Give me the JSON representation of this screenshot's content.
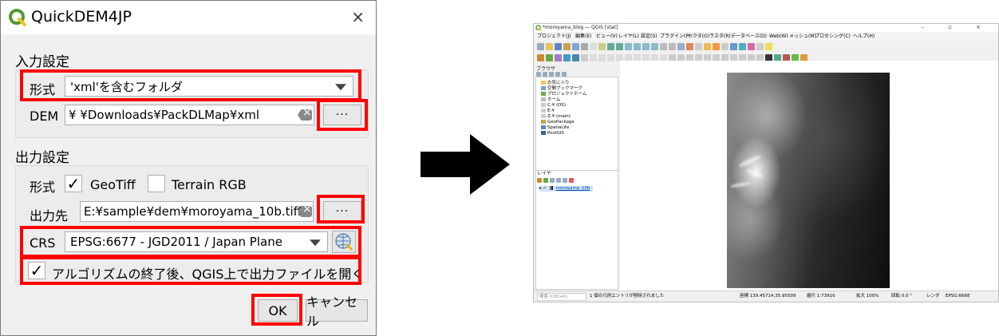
{
  "dialog": {
    "title": "QuickDEM4JP",
    "close": "×",
    "input_section": {
      "title": "入力設定",
      "format_label": "形式",
      "format_value": "'xml'を含むフォルダ",
      "dem_label": "DEM",
      "dem_path": "¥          ¥Downloads¥PackDLMap¥xml",
      "browse_label": "···"
    },
    "output_section": {
      "title": "出力設定",
      "format_label": "形式",
      "geotiff_label": "GeoTiff",
      "geotiff_checked": "✓",
      "terrain_label": "Terrain RGB",
      "output_label": "出力先",
      "output_path": "E:¥sample¥dem¥moroyama_10b.tiff",
      "browse_label": "···",
      "crs_label": "CRS",
      "crs_value": "EPSG:6677 - JGD2011 / Japan Plane",
      "open_check": "✓",
      "open_label": "アルゴリズムの終了後、QGIS上で出力ファイルを開く"
    },
    "ok_label": "OK",
    "cancel_label": "キャンセル"
  },
  "qgis": {
    "title": "*moroyama_blog — QGIS [stat]",
    "window_controls": "–  ▫  ×",
    "menu": [
      "プロジェクト(J)",
      "編集(E)",
      "ビュー(V)",
      "レイヤ(L)",
      "設定(S)",
      "プラグイン(P)",
      "ベクタ(O)",
      "ラスタ(R)",
      "データベース(D)",
      "Web(W)",
      "メッシュ(M)",
      "プロセシング(C)",
      "ヘルプ(H)"
    ],
    "browser_title": "ブラウザ",
    "browser_items": [
      "お気に入り",
      "空間ブックマーク",
      "プロジェクトホーム",
      "ホーム",
      "C:¥ (OS)",
      "E:¥",
      "Z:¥ (main)",
      "GeoPackage",
      "SpatiaLite",
      "PostGIS"
    ],
    "layers_title": "レイヤ",
    "layer_name": "moroyama_10b",
    "status": {
      "search_placeholder": "検索 (Ctrl+K)",
      "message": "1 個の凡例エントリが削除されました",
      "coord": "座標 139.45714,35.95509",
      "scale": "縮尺 1:73916",
      "magnifier": "拡大 100%",
      "rotation": "回転 0.0 °",
      "render": "レンダ",
      "crs": "EPSG:6668"
    }
  },
  "colors": {
    "highlight": "#ff0000",
    "qgis_green": "#589632",
    "qgis_yellow": "#f0c419"
  }
}
